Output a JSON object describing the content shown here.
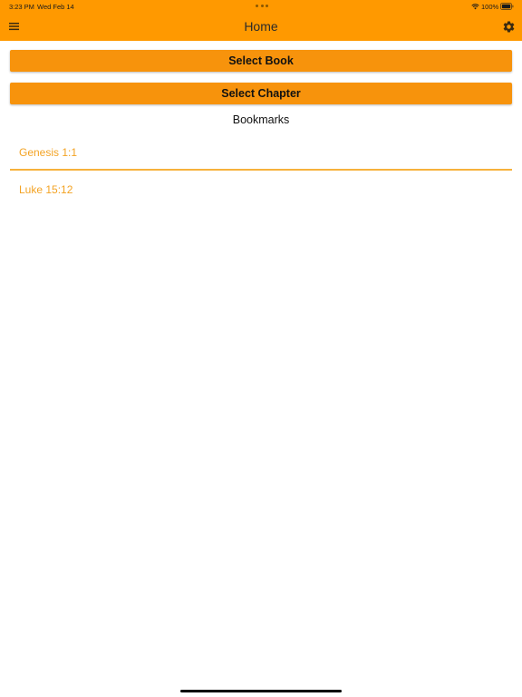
{
  "status_bar": {
    "time": "3:23 PM",
    "date": "Wed Feb 14",
    "battery": "100%"
  },
  "nav": {
    "title": "Home",
    "menu_icon": "hamburger-menu-icon",
    "settings_icon": "gear-icon"
  },
  "buttons": {
    "select_book": "Select Book",
    "select_chapter": "Select Chapter"
  },
  "bookmarks": {
    "heading": "Bookmarks",
    "items": [
      {
        "label": "Genesis 1:1"
      },
      {
        "label": "Luke 15:12"
      }
    ]
  },
  "colors": {
    "accent": "#ff9900",
    "button": "#f7930c",
    "bookmark_text": "#f3a324"
  }
}
